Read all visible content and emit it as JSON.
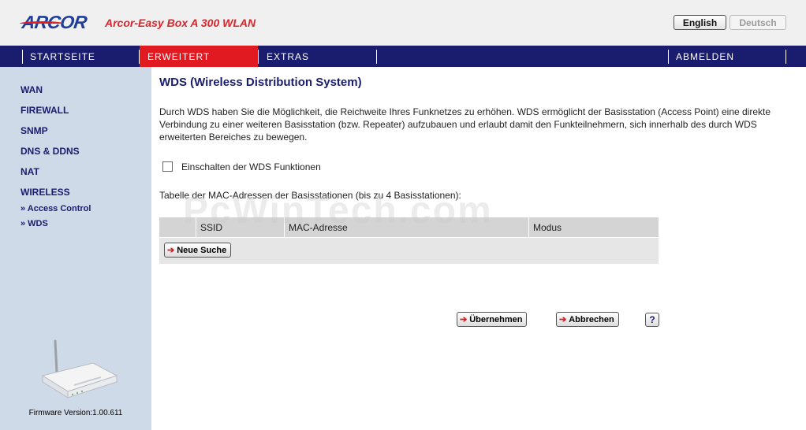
{
  "header": {
    "logo_text": "ARCOR",
    "product_name": "Arcor-Easy Box A 300 WLAN",
    "lang_english": "English",
    "lang_deutsch": "Deutsch"
  },
  "nav": {
    "items": [
      {
        "label": "STARTSEITE",
        "active": false
      },
      {
        "label": "ERWEITERT",
        "active": true
      },
      {
        "label": "EXTRAS",
        "active": false
      },
      {
        "label": "ABMELDEN",
        "active": false
      }
    ]
  },
  "sidebar": {
    "items": [
      {
        "label": "WAN"
      },
      {
        "label": "FIREWALL"
      },
      {
        "label": "SNMP"
      },
      {
        "label": "DNS & DDNS"
      },
      {
        "label": "NAT"
      },
      {
        "label": "WIRELESS"
      }
    ],
    "subitems": [
      {
        "label": "» Access Control"
      },
      {
        "label": "» WDS"
      }
    ],
    "firmware": "Firmware Version:1.00.611"
  },
  "main": {
    "title": "WDS (Wireless Distribution System)",
    "description": "Durch WDS haben Sie die Möglichkeit, die Reichweite Ihres Funknetzes zu erhöhen. WDS ermöglicht der Basisstation (Access Point) eine direkte Verbindung zu einer weiteren Basisstation (bzw. Repeater) aufzubauen und erlaubt damit den Funkteilnehmern, sich innerhalb des durch WDS erweiterten Bereiches zu bewegen.",
    "checkbox_label": "Einschalten der WDS Funktionen",
    "checkbox_checked": false,
    "table_caption": "Tabelle der MAC-Adressen der Basisstationen (bis zu 4 Basisstationen):",
    "table_headers": [
      "",
      "SSID",
      "MAC-Adresse",
      "Modus"
    ],
    "search_button": "Neue Suche",
    "apply_button": "Übernehmen",
    "cancel_button": "Abbrechen",
    "help_button": "?"
  },
  "watermark": "PcWinTech.com",
  "colors": {
    "nav_bg": "#1a1d6e",
    "nav_active": "#e11a22",
    "sidebar_bg": "#cfdae8",
    "title": "#1a1d6e"
  }
}
